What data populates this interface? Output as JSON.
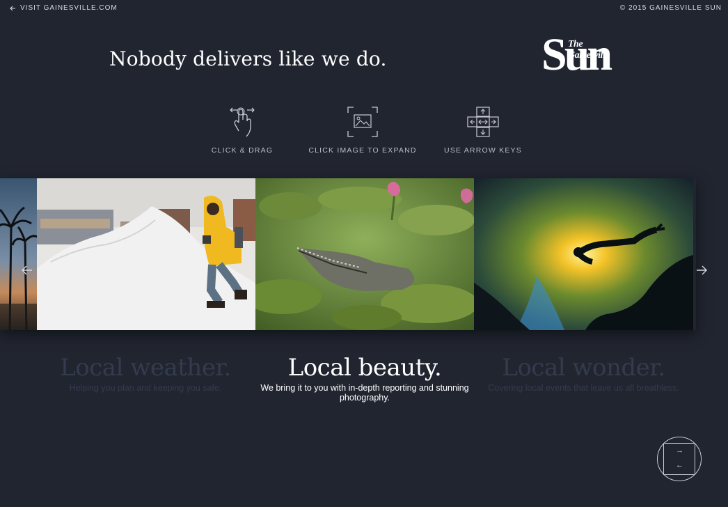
{
  "topbar": {
    "back_label": "VISIT GAINESVILLE.COM",
    "copyright": "© 2015 GAINESVILLE SUN"
  },
  "headline": "Nobody delivers like we do.",
  "logo": {
    "the": "The Gainesville",
    "sun": "Sun"
  },
  "hints": [
    {
      "label": "CLICK & DRAG",
      "icon": "hand-swipe-icon"
    },
    {
      "label": "CLICK IMAGE TO EXPAND",
      "icon": "image-frame-icon"
    },
    {
      "label": "USE ARROW KEYS",
      "icon": "arrow-keys-icon"
    }
  ],
  "slides": [
    {
      "title": "Local weather.",
      "subtitle": "Helping you plan and keeping you safe.",
      "active": false
    },
    {
      "title": "Local beauty.",
      "subtitle": "We bring it to you with in-depth reporting and stunning photography.",
      "active": true
    },
    {
      "title": "Local wonder.",
      "subtitle": "Covering local events that leave us all breathless.",
      "active": false
    }
  ],
  "partial_caption": ".",
  "nav": {
    "right_arrow": "→",
    "left_arrow": "←"
  },
  "colors": {
    "background": "#212530",
    "inactive_caption": "#343b4e",
    "active_caption": "#ffffff"
  }
}
